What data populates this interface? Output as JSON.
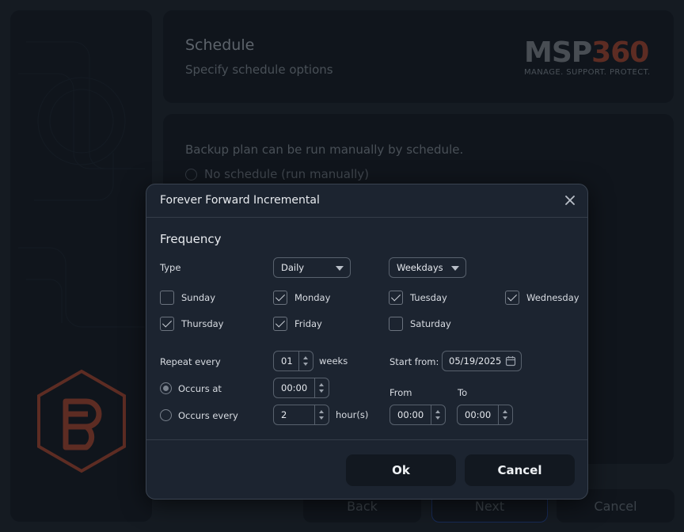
{
  "wizard": {
    "header": {
      "title": "Schedule",
      "subtitle": "Specify schedule options"
    },
    "logo": {
      "word_left": "MSP",
      "word_right": "360",
      "tagline": "MANAGE. SUPPORT. PROTECT."
    },
    "content": {
      "description": "Backup plan can be run manually by schedule.",
      "option_no_schedule": "No schedule (run manually)"
    },
    "footer": {
      "back": "Back",
      "next": "Next",
      "cancel": "Cancel"
    }
  },
  "dialog": {
    "title": "Forever Forward Incremental",
    "section": "Frequency",
    "type_label": "Type",
    "type_value": "Daily",
    "subtype_value": "Weekdays",
    "days": [
      {
        "label": "Sunday",
        "checked": false
      },
      {
        "label": "Monday",
        "checked": true
      },
      {
        "label": "Tuesday",
        "checked": true
      },
      {
        "label": "Wednesday",
        "checked": true
      },
      {
        "label": "Thursday",
        "checked": true
      },
      {
        "label": "Friday",
        "checked": true
      },
      {
        "label": "Saturday",
        "checked": false
      }
    ],
    "repeat_label": "Repeat every",
    "repeat_value": "01",
    "repeat_unit": "weeks",
    "start_label": "Start from:",
    "start_value": "05/19/2025",
    "occurs_at_label": "Occurs at",
    "occurs_at_value": "00:00",
    "occurs_every_label": "Occurs every",
    "occurs_every_value": "2",
    "occurs_every_unit": "hour(s)",
    "from_label": "From",
    "from_value": "00:00",
    "to_label": "To",
    "to_value": "00:00",
    "ok": "Ok",
    "cancel": "Cancel"
  },
  "colors": {
    "logo_gray": "#6a6f77",
    "logo_accent": "#8a3d2d",
    "dialog_bg": "#1c2430"
  }
}
